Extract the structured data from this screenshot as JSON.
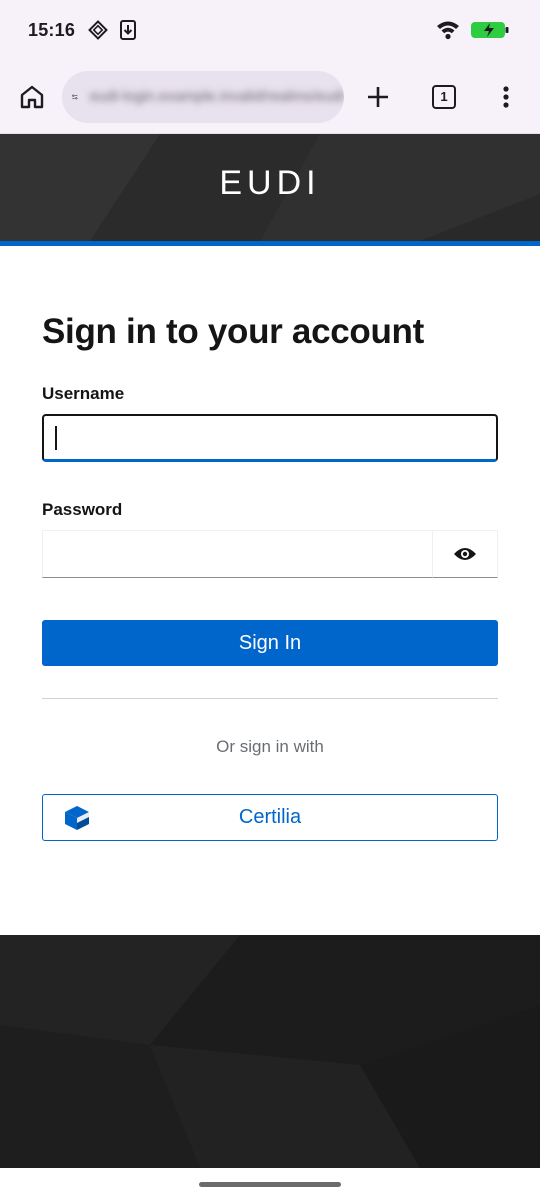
{
  "status_bar": {
    "time": "15:16",
    "icons": [
      "sim-diamond-icon",
      "download-icon",
      "wifi-icon",
      "battery-charging-icon"
    ],
    "battery_color": "#2ecc40"
  },
  "browser": {
    "url": "eudi-login.example.invalid/realms/eudi",
    "tab_count": "1",
    "icons": [
      "home-icon",
      "site-settings-icon",
      "new-tab-plus-icon",
      "tabs-icon",
      "more-vert-icon"
    ]
  },
  "header": {
    "brand": "EUDI"
  },
  "form": {
    "title": "Sign in to your account",
    "username_label": "Username",
    "username_value": "",
    "password_label": "Password",
    "password_value": "",
    "show_password_icon": "eye-icon",
    "submit_label": "Sign In",
    "alt_text": "Or sign in with",
    "provider": {
      "label": "Certilia",
      "icon": "cube-icon"
    }
  },
  "colors": {
    "accent": "#0066cc",
    "header_bg": "#2e2e2e",
    "footer_bg": "#1f1f1f",
    "chrome_bg": "#f7f2fa"
  }
}
